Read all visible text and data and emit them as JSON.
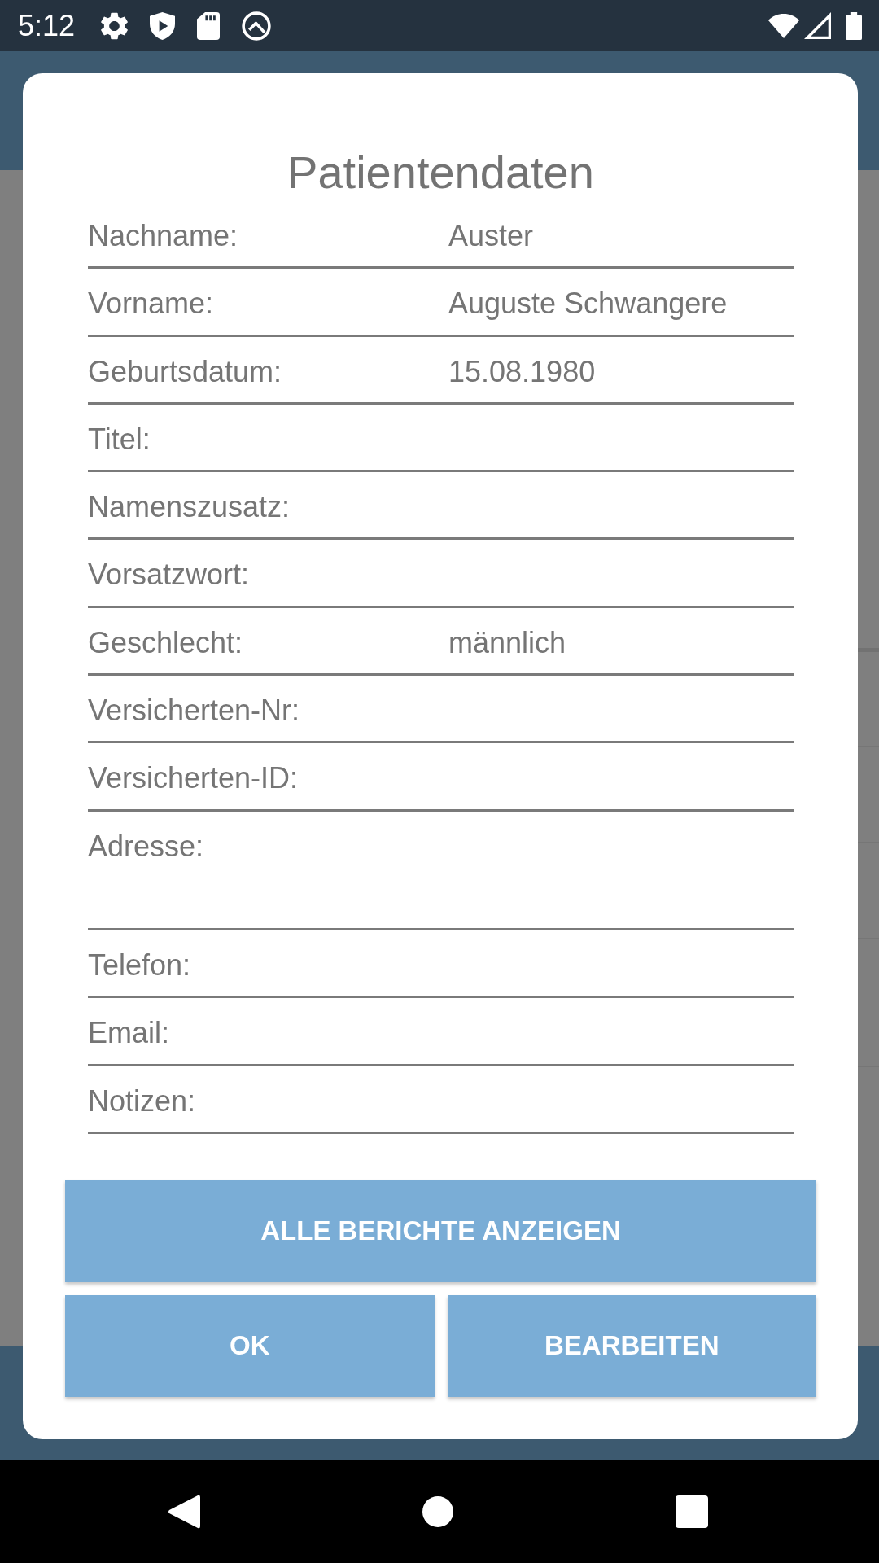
{
  "status_bar": {
    "time": "5:12"
  },
  "dialog": {
    "title": "Patientendaten",
    "fields": [
      {
        "kind": "single",
        "label": "Nachname:",
        "value": "Auster"
      },
      {
        "kind": "single",
        "label": "Vorname:",
        "value": "Auguste Schwangere"
      },
      {
        "kind": "single",
        "label": "Geburtsdatum:",
        "value": "15.08.1980"
      },
      {
        "kind": "single",
        "label": "Titel:"
      },
      {
        "kind": "single",
        "label": "Namenszusatz:"
      },
      {
        "kind": "single",
        "label": "Vorsatzwort:"
      },
      {
        "kind": "single",
        "label": "Geschlecht:",
        "value": "männlich"
      },
      {
        "kind": "single",
        "label": "Versicherten-Nr:"
      },
      {
        "kind": "single",
        "label": "Versicherten-ID:"
      },
      {
        "kind": "multiline",
        "label": "Adresse:"
      },
      {
        "kind": "single",
        "label": "Telefon:"
      },
      {
        "kind": "single",
        "label": "Email:"
      },
      {
        "kind": "single",
        "label": "Notizen:"
      }
    ],
    "buttons": [
      {
        "kind": "wide",
        "label": "ALLE BERICHTE ANZEIGEN"
      },
      {
        "kind": "half",
        "label": "OK"
      },
      {
        "kind": "half",
        "label": "BEARBEITEN"
      }
    ]
  }
}
